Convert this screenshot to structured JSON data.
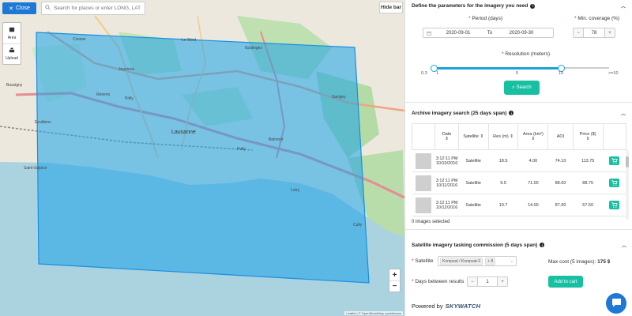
{
  "map": {
    "close_label": "Close",
    "search_placeholder": "Search for places or enter LONG, LAT",
    "hide_bar_label": "Hide bar",
    "tools": [
      {
        "label": "Area"
      },
      {
        "label": "Upload"
      }
    ],
    "zoom_in": "+",
    "zoom_out": "−",
    "attribution": "Leaflet | © OpenStreetMap contributors",
    "places": [
      "Crissier",
      "Renens",
      "Prilly",
      "Lausanne",
      "Ecublens",
      "Saint-Sulpice",
      "Pully",
      "Belmont",
      "Lutry",
      "Cully",
      "Epalinges",
      "Le Mont",
      "Jouxtens",
      "Bussigny",
      "Savigny"
    ],
    "accent": "#1e78d6",
    "aoi_fill": "#1aa3ea"
  },
  "panel": {
    "define": {
      "title": "Define the parameters for the imagery you need",
      "period_label": "Period (days)",
      "date_from": "2020-09-01",
      "date_sep": "To",
      "date_to": "2020-09-30",
      "coverage_label": "Min. coverage (%)",
      "coverage_value": "78",
      "resolution_label": "Resolution (meters)",
      "res_min": "0.3",
      "res_max": ">=10",
      "res_ticks": [
        "1",
        "5",
        "10"
      ],
      "res_range": [
        1,
        10
      ],
      "search_label": "Search"
    },
    "archive": {
      "title": "Archive imagery search (25 days span)",
      "headers": [
        "",
        "Date",
        "Satellite",
        "Res (m)",
        "Area (km²)",
        "AOI",
        "Price ($)",
        ""
      ],
      "rows": [
        {
          "time": "3:12:11 PM",
          "date": "10/10/2016",
          "satellite": "Satellite",
          "res": "18.5",
          "area": "4.00",
          "aoi": "74.10",
          "price": "113.75"
        },
        {
          "time": "3:12:11 PM",
          "date": "10/11/2016",
          "satellite": "Satellite",
          "res": "9.5",
          "area": "71.00",
          "aoi": "88.60",
          "price": "88.75"
        },
        {
          "time": "3:12:11 PM",
          "date": "10/12/2016",
          "satellite": "Satellite",
          "res": "19.7",
          "area": "14.00",
          "aoi": "87.90",
          "price": "67.50"
        }
      ],
      "selected_text": "0 images selected"
    },
    "tasking": {
      "title": "Satellite imagery tasking commission (5 days span)",
      "satellite_label": "Satellite",
      "satellite_chip": "Kompsat / Kompsat-3",
      "satellite_more": "+ 8",
      "max_cost_label": "Max cost (5 images):",
      "max_cost_value": "175 $",
      "days_label": "Days between results",
      "days_value": "1",
      "add_to_cart": "Add to cart"
    },
    "powered_by": "Powered by",
    "brand": "SKYWATCH",
    "brand_color": "#17c0a0"
  }
}
